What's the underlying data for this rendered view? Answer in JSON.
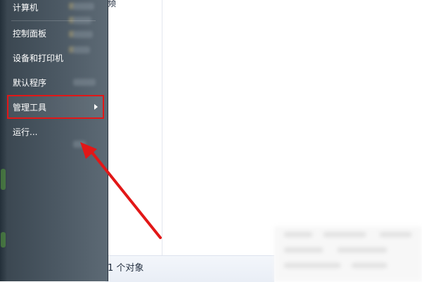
{
  "explorer": {
    "partial_label": "频",
    "status_text": "1 个对象"
  },
  "start_menu": {
    "items": [
      {
        "label": "计算机"
      },
      {
        "label": "控制面板"
      },
      {
        "label": "设备和打印机"
      },
      {
        "label": "默认程序"
      },
      {
        "label": "管理工具"
      },
      {
        "label": "运行..."
      }
    ],
    "highlighted_item": "管理工具"
  },
  "annotation": {
    "arrow_color": "#e21717",
    "box_color": "#e21717"
  },
  "icons": [
    "submenu-arrow-icon",
    "annotation-arrow-icon"
  ]
}
